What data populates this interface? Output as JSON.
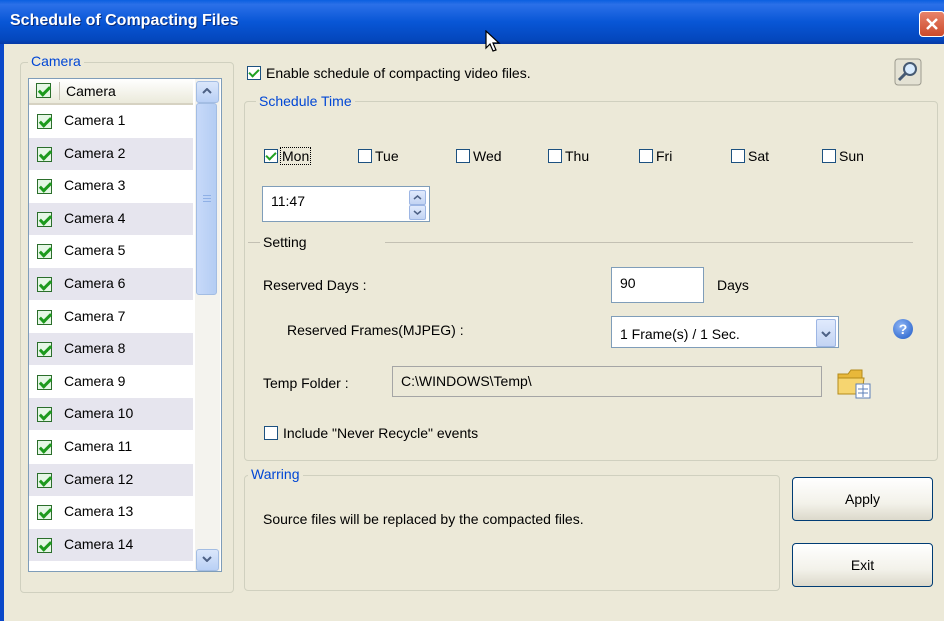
{
  "window": {
    "title": "Schedule of Compacting Files"
  },
  "camera_group": {
    "legend": "Camera",
    "header": "Camera",
    "items": [
      {
        "label": "Camera 1",
        "checked": true
      },
      {
        "label": "Camera 2",
        "checked": true
      },
      {
        "label": "Camera 3",
        "checked": true
      },
      {
        "label": "Camera 4",
        "checked": true
      },
      {
        "label": "Camera 5",
        "checked": true
      },
      {
        "label": "Camera 6",
        "checked": true
      },
      {
        "label": "Camera 7",
        "checked": true
      },
      {
        "label": "Camera 8",
        "checked": true
      },
      {
        "label": "Camera 9",
        "checked": true
      },
      {
        "label": "Camera 10",
        "checked": true
      },
      {
        "label": "Camera 11",
        "checked": true
      },
      {
        "label": "Camera 12",
        "checked": true
      },
      {
        "label": "Camera 13",
        "checked": true
      },
      {
        "label": "Camera 14",
        "checked": true
      }
    ]
  },
  "enable_schedule": {
    "label": "Enable schedule of compacting video files.",
    "checked": true
  },
  "schedule_time": {
    "legend": "Schedule Time",
    "days": [
      {
        "label": "Mon",
        "checked": true
      },
      {
        "label": "Tue",
        "checked": false
      },
      {
        "label": "Wed",
        "checked": false
      },
      {
        "label": "Thu",
        "checked": false
      },
      {
        "label": "Fri",
        "checked": false
      },
      {
        "label": "Sat",
        "checked": false
      },
      {
        "label": "Sun",
        "checked": false
      }
    ],
    "time": "11:47"
  },
  "setting": {
    "title": "Setting",
    "reserved_days_label": "Reserved Days :",
    "reserved_days_value": "90",
    "days_unit": "Days",
    "reserved_frames_label": "Reserved Frames(MJPEG) :",
    "reserved_frames_value": "1 Frame(s) / 1 Sec.",
    "temp_folder_label": "Temp Folder :",
    "temp_folder_value": "C:\\WINDOWS\\Temp\\",
    "include_never_recycle": {
      "label": "Include \"Never Recycle\" events",
      "checked": false
    }
  },
  "warring": {
    "legend": "Warring",
    "message": "Source files will be replaced by the compacted files."
  },
  "buttons": {
    "apply": "Apply",
    "exit": "Exit"
  },
  "icons": {
    "help": "?"
  },
  "colors": {
    "title_bar": "#0a5fe0",
    "group_legend": "#0046d5",
    "check_green": "#21a121"
  }
}
